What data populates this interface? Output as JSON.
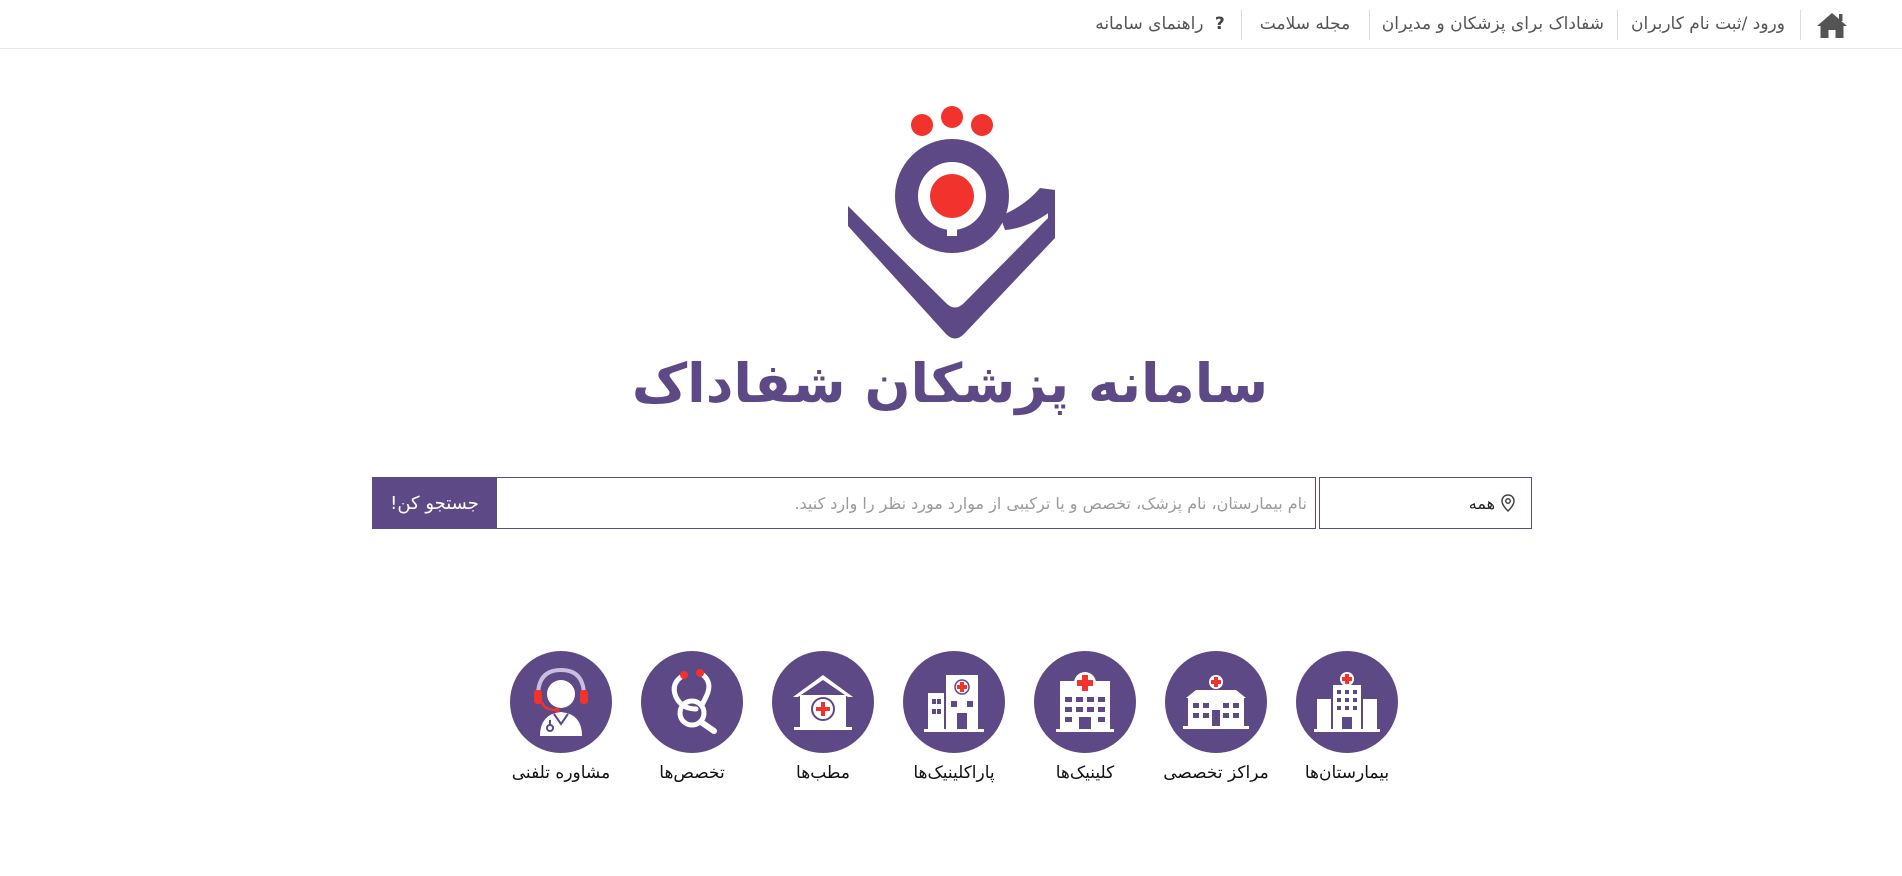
{
  "colors": {
    "brand": "#5e4987",
    "accent": "#f2322c",
    "nav_text": "#555555"
  },
  "nav": {
    "home_icon": "home-icon",
    "login": "ورود /ثبت نام کاربران",
    "for_doctors": "شفاداک برای پزشکان و مدیران",
    "magazine": "مجله سلامت",
    "help_symbol": "?",
    "help": "راهنمای سامانه"
  },
  "brand": {
    "title": "سامانه پزشکان شفاداک"
  },
  "search": {
    "location_value": "همه",
    "location_icon": "map-pin-icon",
    "placeholder": "نام بیمارستان، نام پزشک، تخصص و یا ترکیبی از موارد مورد نظر را وارد کنید.",
    "button": "جستجو کن!"
  },
  "categories": [
    {
      "label": "بیمارستان‌ها",
      "icon": "hospital-icon"
    },
    {
      "label": "مراکز تخصصی",
      "icon": "specialty-center-icon"
    },
    {
      "label": "کلینیک‌ها",
      "icon": "clinic-icon"
    },
    {
      "label": "پاراکلینیک‌ها",
      "icon": "paraclinic-icon"
    },
    {
      "label": "مطب‌ها",
      "icon": "office-icon"
    },
    {
      "label": "تخصص‌ها",
      "icon": "stethoscope-icon"
    },
    {
      "label": "مشاوره تلفنی",
      "icon": "phone-consult-icon"
    }
  ]
}
